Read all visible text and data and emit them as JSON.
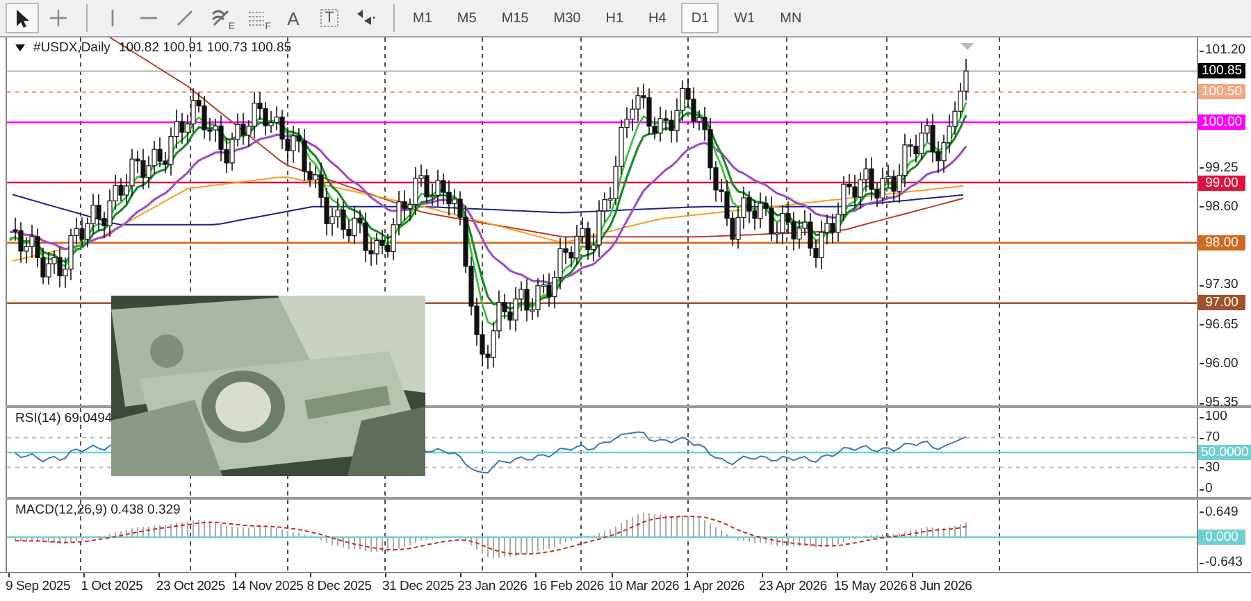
{
  "toolbar": {
    "tools": [
      {
        "kind": "pointer",
        "selected": true
      },
      {
        "kind": "crosshair",
        "selected": false
      },
      {
        "kind": "separator"
      },
      {
        "kind": "vline",
        "selected": false
      },
      {
        "kind": "hline",
        "selected": false
      },
      {
        "kind": "trendline",
        "selected": false
      },
      {
        "kind": "fibo",
        "glyph": "E",
        "selected": false
      },
      {
        "kind": "grid",
        "glyph": "F",
        "selected": false
      },
      {
        "kind": "text",
        "glyph": "A",
        "selected": false
      },
      {
        "kind": "label",
        "glyph": "T",
        "selected": false
      },
      {
        "kind": "shapes",
        "selected": false
      }
    ],
    "timeframes": [
      {
        "label": "M1",
        "selected": false
      },
      {
        "label": "M5",
        "selected": false
      },
      {
        "label": "M15",
        "selected": false
      },
      {
        "label": "M30",
        "selected": false
      },
      {
        "label": "H1",
        "selected": false
      },
      {
        "label": "H4",
        "selected": false
      },
      {
        "label": "D1",
        "selected": true
      },
      {
        "label": "W1",
        "selected": false
      },
      {
        "label": "MN",
        "selected": false
      }
    ]
  },
  "chart": {
    "symbol": "#USDX,Daily",
    "ohlc": "100.82 100.91 100.73 100.85",
    "price_ticks": [
      "101.20",
      "99.25",
      "98.60",
      "97.30",
      "96.65",
      "96.00",
      "95.35"
    ],
    "current_price": "100.85",
    "levels": [
      {
        "price": "100.50",
        "color": "#f4a582",
        "kind": "dashed"
      },
      {
        "price": "100.00",
        "color": "#ff00ff",
        "kind": "solid"
      },
      {
        "price": "99.00",
        "color": "#dc143c",
        "kind": "solid"
      },
      {
        "price": "98.00",
        "color": "#d2691e",
        "kind": "solid"
      },
      {
        "price": "97.00",
        "color": "#a0522d",
        "kind": "solid"
      }
    ]
  },
  "rsi": {
    "label": "RSI(14) 69.0494",
    "ticks": [
      "100",
      "70",
      "30",
      "0"
    ],
    "reference_line": "50.0000"
  },
  "macd": {
    "label": "MACD(12,26,9) 0.438 0.329",
    "ticks": [
      "0.649",
      "-0.643"
    ],
    "zero_line": "0.000"
  },
  "dates": [
    "9 Sep 2025",
    "1 Oct 2025",
    "23 Oct 2025",
    "14 Nov 2025",
    "8 Dec 2025",
    "31 Dec 2025",
    "23 Jan 2026",
    "16 Feb 2026",
    "10 Mar 2026",
    "1 Apr 2026",
    "23 Apr 2026",
    "15 May 2026",
    "8 Jun 2026"
  ]
}
